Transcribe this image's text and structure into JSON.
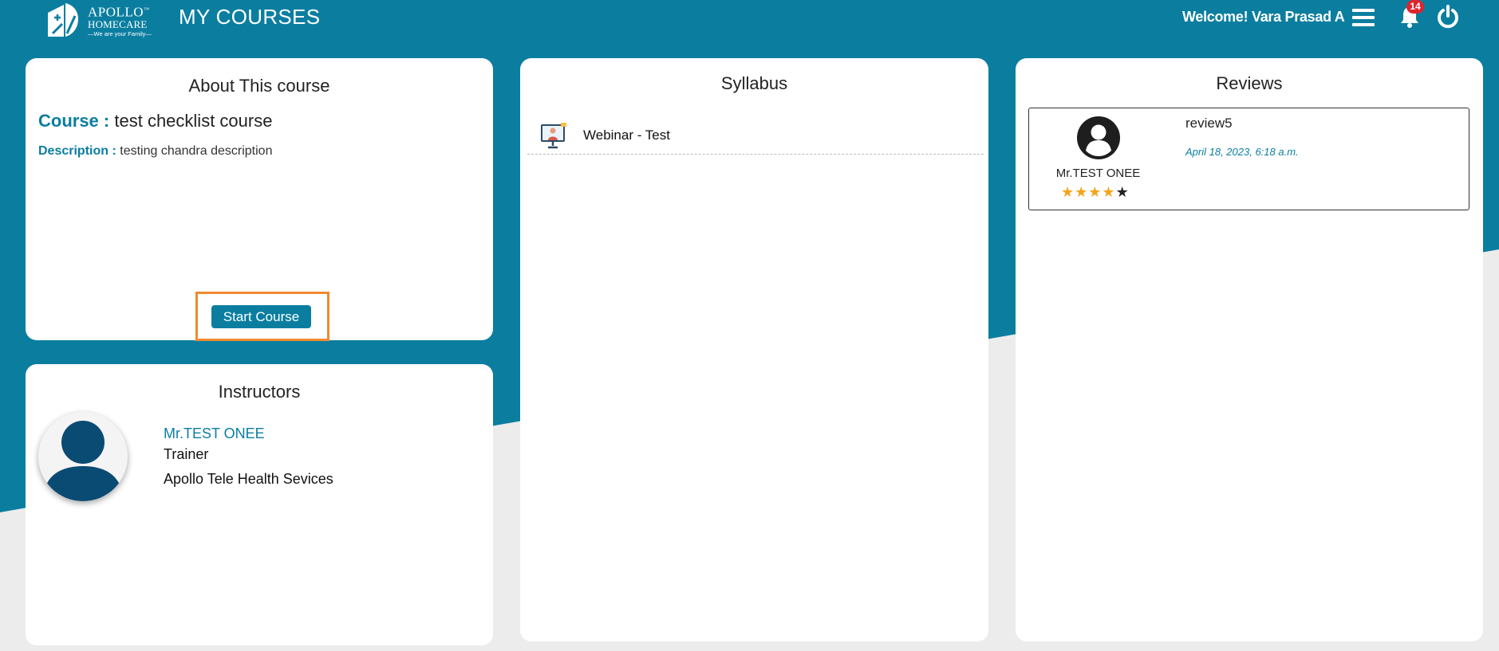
{
  "brand": {
    "name_top": "APOLLO",
    "trademark": "™",
    "name_bottom": "HOMECARE",
    "tagline": "—We are your Family—"
  },
  "header": {
    "page_title": "MY COURSES",
    "welcome_text": "Welcome! Vara Prasad A",
    "notification_count": "14",
    "icons": [
      "menu-icon",
      "bell-icon",
      "power-icon"
    ]
  },
  "about": {
    "title": "About This course",
    "course_label": "Course :",
    "course_name": "test checklist course",
    "description_label": "Description :",
    "description": "testing chandra description",
    "start_button": "Start Course"
  },
  "instructors": {
    "title": "Instructors",
    "items": [
      {
        "name": "Mr.TEST ONEE",
        "role": "Trainer",
        "organization": "Apollo Tele Health Sevices"
      }
    ]
  },
  "syllabus": {
    "title": "Syllabus",
    "items": [
      {
        "label": "Webinar - Test",
        "icon": "webinar-icon"
      }
    ]
  },
  "reviews": {
    "title": "Reviews",
    "items": [
      {
        "reviewer": "Mr.TEST ONEE",
        "rating": 4,
        "max_rating": 5,
        "text": "review5",
        "date": "April 18, 2023, 6:18 a.m."
      }
    ]
  },
  "colors": {
    "primary": "#0b7ea0",
    "page_background": "#ececec",
    "highlight_border": "#f08a30",
    "badge": "#e0242e",
    "star": "#f4a31b"
  }
}
